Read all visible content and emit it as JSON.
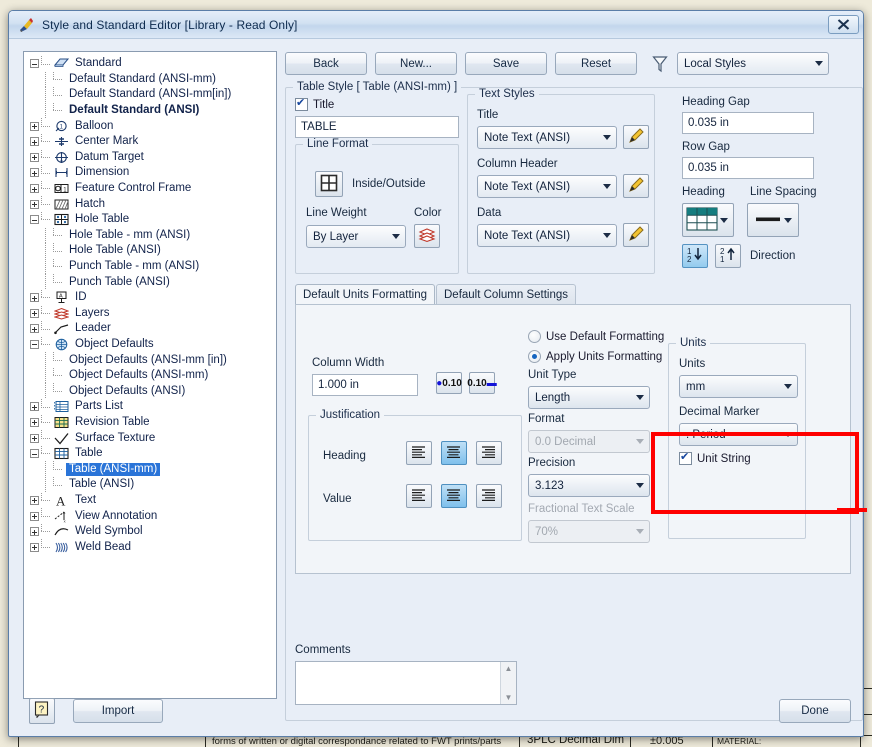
{
  "window": {
    "title": "Style and Standard Editor [Library - Read Only]",
    "icon": "style-editor-icon",
    "close_label": "✕"
  },
  "toolbar": {
    "back_label": "Back",
    "new_label": "New...",
    "save_label": "Save",
    "reset_label": "Reset",
    "filter_icon": "filter-funnel-icon",
    "scope_value": "Local Styles"
  },
  "tree": {
    "items": [
      {
        "label": "Standard",
        "depth": 0,
        "toggle": "minus",
        "icon": "standard-book-icon"
      },
      {
        "label": "Default Standard (ANSI-mm)",
        "depth": 1,
        "toggle": "leaf",
        "icon": ""
      },
      {
        "label": "Default Standard (ANSI-mm[in])",
        "depth": 1,
        "toggle": "leaf",
        "icon": ""
      },
      {
        "label": "Default Standard (ANSI)",
        "depth": 1,
        "toggle": "leaf",
        "icon": "",
        "bold": true
      },
      {
        "label": "Balloon",
        "depth": 0,
        "toggle": "plus",
        "icon": "balloon-icon"
      },
      {
        "label": "Center Mark",
        "depth": 0,
        "toggle": "plus",
        "icon": "center-mark-icon"
      },
      {
        "label": "Datum Target",
        "depth": 0,
        "toggle": "plus",
        "icon": "datum-target-icon"
      },
      {
        "label": "Dimension",
        "depth": 0,
        "toggle": "plus",
        "icon": "dimension-icon"
      },
      {
        "label": "Feature Control Frame",
        "depth": 0,
        "toggle": "plus",
        "icon": "feature-control-frame-icon"
      },
      {
        "label": "Hatch",
        "depth": 0,
        "toggle": "plus",
        "icon": "hatch-icon"
      },
      {
        "label": "Hole Table",
        "depth": 0,
        "toggle": "minus",
        "icon": "hole-table-icon"
      },
      {
        "label": "Hole Table - mm (ANSI)",
        "depth": 1,
        "toggle": "leaf",
        "icon": ""
      },
      {
        "label": "Hole Table (ANSI)",
        "depth": 1,
        "toggle": "leaf",
        "icon": ""
      },
      {
        "label": "Punch Table - mm (ANSI)",
        "depth": 1,
        "toggle": "leaf",
        "icon": ""
      },
      {
        "label": "Punch Table (ANSI)",
        "depth": 1,
        "toggle": "leaf",
        "icon": ""
      },
      {
        "label": "ID",
        "depth": 0,
        "toggle": "plus",
        "icon": "id-icon"
      },
      {
        "label": "Layers",
        "depth": 0,
        "toggle": "plus",
        "icon": "layers-icon"
      },
      {
        "label": "Leader",
        "depth": 0,
        "toggle": "plus",
        "icon": "leader-icon"
      },
      {
        "label": "Object Defaults",
        "depth": 0,
        "toggle": "minus",
        "icon": "object-defaults-icon"
      },
      {
        "label": "Object Defaults (ANSI-mm [in])",
        "depth": 1,
        "toggle": "leaf",
        "icon": ""
      },
      {
        "label": "Object Defaults (ANSI-mm)",
        "depth": 1,
        "toggle": "leaf",
        "icon": ""
      },
      {
        "label": "Object Defaults (ANSI)",
        "depth": 1,
        "toggle": "leaf",
        "icon": ""
      },
      {
        "label": "Parts List",
        "depth": 0,
        "toggle": "plus",
        "icon": "parts-list-icon"
      },
      {
        "label": "Revision Table",
        "depth": 0,
        "toggle": "plus",
        "icon": "revision-table-icon"
      },
      {
        "label": "Surface Texture",
        "depth": 0,
        "toggle": "plus",
        "icon": "surface-texture-icon"
      },
      {
        "label": "Table",
        "depth": 0,
        "toggle": "minus",
        "icon": "table-icon"
      },
      {
        "label": "Table (ANSI-mm)",
        "depth": 1,
        "toggle": "leaf",
        "icon": "",
        "selected": true
      },
      {
        "label": "Table (ANSI)",
        "depth": 1,
        "toggle": "leaf",
        "icon": ""
      },
      {
        "label": "Text",
        "depth": 0,
        "toggle": "plus",
        "icon": "text-a-icon"
      },
      {
        "label": "View Annotation",
        "depth": 0,
        "toggle": "plus",
        "icon": "view-annotation-icon"
      },
      {
        "label": "Weld Symbol",
        "depth": 0,
        "toggle": "plus",
        "icon": "weld-symbol-icon"
      },
      {
        "label": "Weld Bead",
        "depth": 0,
        "toggle": "plus",
        "icon": "weld-bead-icon"
      }
    ]
  },
  "style_group": {
    "caption": "Table Style [ Table (ANSI-mm) ]"
  },
  "title_section": {
    "checkbox_label": "Title",
    "checked": true,
    "value": "TABLE"
  },
  "line_format": {
    "caption": "Line Format",
    "inside_outside_label": "Inside/Outside",
    "inside_outside_icon": "inside-outside-grid-icon",
    "line_weight_label": "Line Weight",
    "line_weight_value": "By Layer",
    "color_label": "Color",
    "color_icon": "layers-color-icon"
  },
  "text_styles": {
    "caption": "Text Styles",
    "rows": [
      {
        "label": "Title",
        "value": "Note Text (ANSI)",
        "edit_icon": "pencil-edit-icon"
      },
      {
        "label": "Column Header",
        "value": "Note Text (ANSI)",
        "edit_icon": "pencil-edit-icon"
      },
      {
        "label": "Data",
        "value": "Note Text (ANSI)",
        "edit_icon": "pencil-edit-icon"
      }
    ]
  },
  "spacing": {
    "heading_gap_label": "Heading Gap",
    "heading_gap_value": "0.035 in",
    "row_gap_label": "Row Gap",
    "row_gap_value": "0.035 in",
    "heading_label": "Heading",
    "heading_icon": "table-heading-top-row-icon",
    "line_spacing_label": "Line Spacing",
    "line_spacing_icon": "thick-line-icon",
    "direction_label": "Direction",
    "direction_down_icon": "order-1-2-down-icon",
    "direction_up_icon": "order-2-1-up-icon",
    "direction_selected": "down"
  },
  "tabs": [
    {
      "label": "Default Units Formatting",
      "active": true
    },
    {
      "label": "Default Column Settings",
      "active": false
    }
  ],
  "units_formatting": {
    "column_width_label": "Column Width",
    "column_width_value": "1.000 in",
    "stepper_left_label": "0.10",
    "stepper_right_label": "0.10",
    "stepper_left_icon": "decimal-decrease-icon",
    "stepper_right_icon": "decimal-increase-icon",
    "justification_caption": "Justification",
    "heading_row_label": "Heading",
    "value_row_label": "Value",
    "justify_icons": [
      "align-left-icon",
      "align-center-icon",
      "align-right-icon"
    ],
    "heading_justify_selected": 1,
    "value_justify_selected": 1,
    "use_default_label": "Use Default Formatting",
    "apply_units_label": "Apply Units Formatting",
    "mode_selected": "apply",
    "unit_type_label": "Unit Type",
    "unit_type_value": "Length",
    "format_label": "Format",
    "format_value": "0.0 Decimal",
    "format_disabled": true,
    "precision_label": "Precision",
    "precision_value": "3.123",
    "fractional_text_scale_label": "Fractional Text Scale",
    "fractional_text_scale_value": "70%",
    "fractional_disabled": true,
    "units_group": {
      "caption": "Units",
      "units_label": "Units",
      "units_value": "mm",
      "decimal_marker_label": "Decimal Marker",
      "decimal_marker_value": ". Period",
      "unit_string_label": "Unit String",
      "unit_string_checked": true
    }
  },
  "comments": {
    "label": "Comments",
    "value": ""
  },
  "footer": {
    "help_label": "?",
    "help_icon": "help-question-icon",
    "import_label": "Import",
    "done_label": "Done"
  },
  "annotation": {
    "highlight_color": "#ff0000",
    "target": "decimal-marker-dropdown"
  },
  "background_drawing": {
    "note_text": "forms of written or digital correspondance related to FWT prints/parts",
    "dim_label": "3PLC Decimal Dim",
    "dim_tolerance": "±0.005",
    "material_label": "MATERIAL:"
  }
}
